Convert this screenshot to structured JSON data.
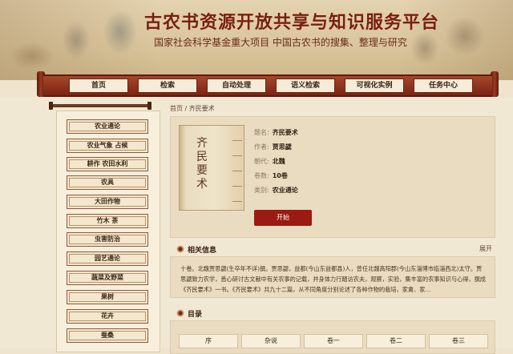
{
  "header": {
    "title": "古农书资源开放共享与知识服务平台",
    "subtitle": "国家社会科学基金重大项目 中国古农书的搜集、整理与研究"
  },
  "nav": {
    "items": [
      "首页",
      "检索",
      "自动处理",
      "语义检索",
      "可视化实例",
      "任务中心"
    ]
  },
  "sidebar": {
    "items": [
      "农业通论",
      "农业气象 占候",
      "耕作 农田水利",
      "农具",
      "大田作物",
      "竹木 茶",
      "虫害防治",
      "园艺通论",
      "蔬菜及野菜",
      "果树",
      "花卉",
      "蚕桑"
    ]
  },
  "breadcrumb": {
    "home": "首页",
    "separator": " / ",
    "current": "齐民要术"
  },
  "book": {
    "cover_title": "齐民要术",
    "fields": [
      {
        "label": "题名:",
        "value": "齐民要术"
      },
      {
        "label": "作者:",
        "value": "贾思勰"
      },
      {
        "label": "朝代:",
        "value": "北魏"
      },
      {
        "label": "卷数:",
        "value": "10卷"
      },
      {
        "label": "类别:",
        "value": "农业通论"
      }
    ],
    "start_label": "开始"
  },
  "related": {
    "title": "相关信息",
    "expand_label": "展开",
    "text": "十卷。北魏贾思勰(生卒年不详)撰。贾思勰，益都(今山东益都县)人，曾任北魏高阳郡(今山东淄博市临淄西北)太守。贾思勰致力农学，悉心研讨古文献中有关农事的记载，并身体力行踏访农夫，观察，实验，集丰富的农事知识与心得，撰成《齐民要术》一书。《齐民要术》共九十二篇，从不同角度分别论述了各种作物的栽培，家禽、家..."
  },
  "toc": {
    "title": "目录",
    "items": [
      "序",
      "杂说",
      "卷一",
      "卷二",
      "卷三"
    ]
  },
  "colors": {
    "accent": "#9b1b12",
    "nav_bar": "#8b2e18",
    "title_red": "#7a1f12",
    "background": "#efe5cf"
  }
}
